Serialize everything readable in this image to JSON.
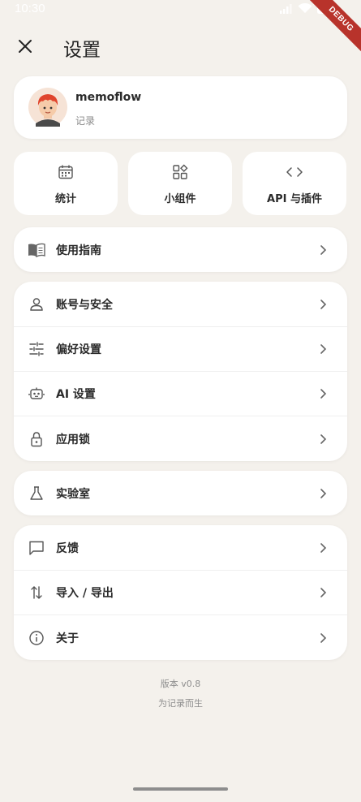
{
  "status_bar": {
    "time": "10:30",
    "debug_label": "DEBUG"
  },
  "header": {
    "title": "设置"
  },
  "profile": {
    "name": "memoflow",
    "subtitle": "记录"
  },
  "quick_actions": [
    {
      "label": "统计",
      "icon": "calendar-icon"
    },
    {
      "label": "小组件",
      "icon": "widgets-icon"
    },
    {
      "label": "API 与插件",
      "icon": "code-icon"
    }
  ],
  "groups": {
    "guide": {
      "items": [
        {
          "label": "使用指南",
          "icon": "book-icon"
        }
      ]
    },
    "account": {
      "items": [
        {
          "label": "账号与安全",
          "icon": "person-icon"
        },
        {
          "label": "偏好设置",
          "icon": "sliders-icon"
        },
        {
          "label": "AI 设置",
          "icon": "robot-icon"
        },
        {
          "label": "应用锁",
          "icon": "lock-icon"
        }
      ]
    },
    "lab": {
      "items": [
        {
          "label": "实验室",
          "icon": "flask-icon"
        }
      ]
    },
    "misc": {
      "items": [
        {
          "label": "反馈",
          "icon": "chat-icon"
        },
        {
          "label": "导入 / 导出",
          "icon": "swap-icon"
        },
        {
          "label": "关于",
          "icon": "info-icon"
        }
      ]
    }
  },
  "footer": {
    "version": "版本 v0.8",
    "motto": "为记录而生"
  },
  "colors": {
    "background": "#f4f1ec",
    "card": "#ffffff",
    "text": "#2b2b2b",
    "muted": "#8a8a8a",
    "debug": "#b8332b"
  }
}
